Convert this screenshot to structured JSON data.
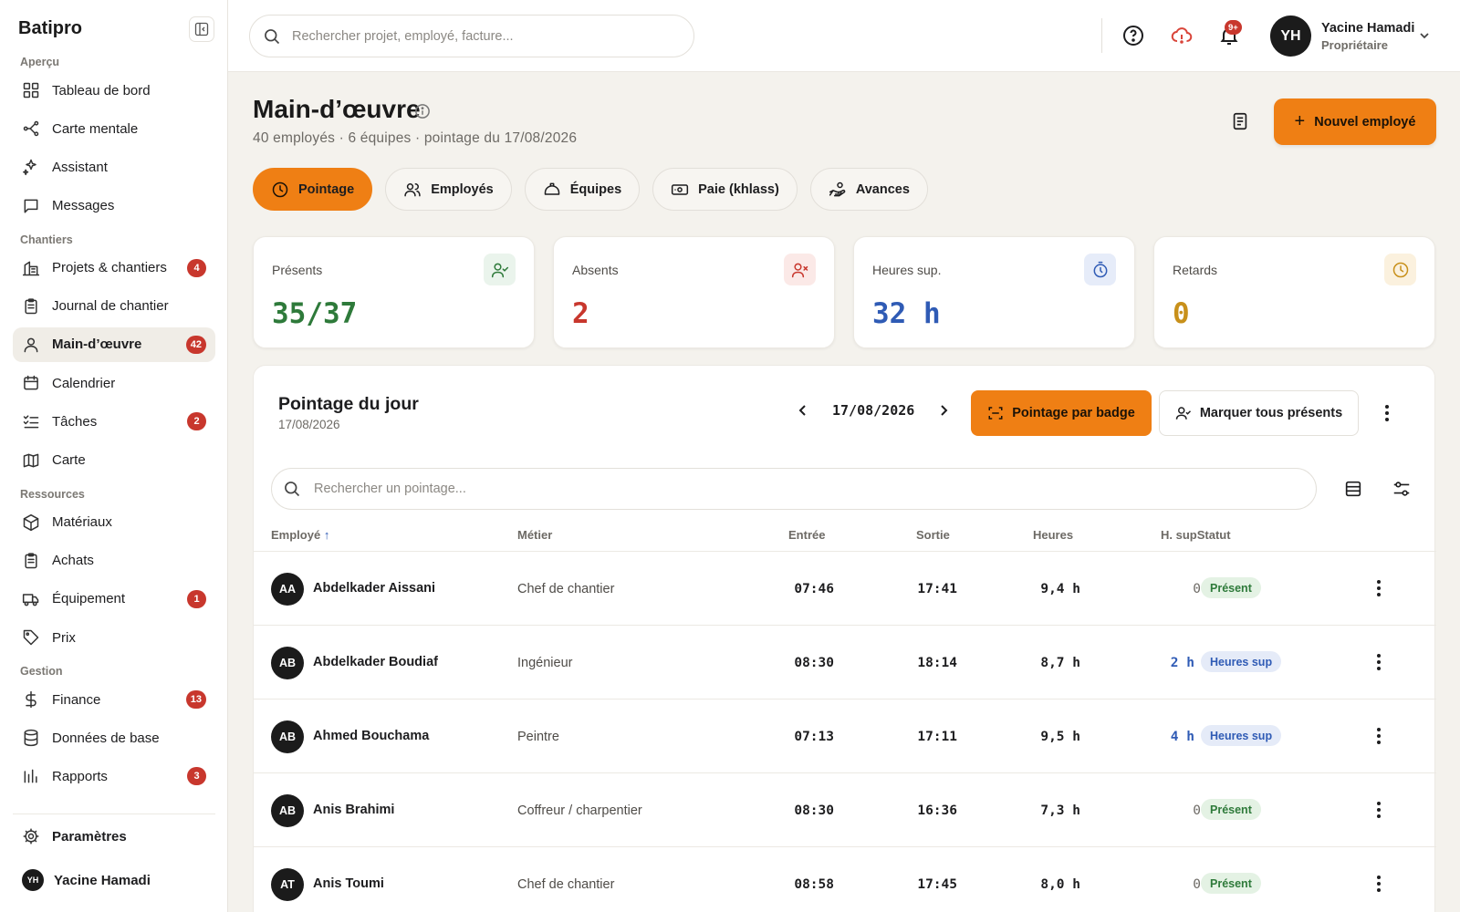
{
  "app": {
    "brand": "Batipro"
  },
  "sidebar": {
    "sections": [
      {
        "title": "Aperçu",
        "items": [
          {
            "label": "Tableau de bord",
            "icon": "dashboard-icon"
          },
          {
            "label": "Carte mentale",
            "icon": "mindmap-icon"
          },
          {
            "label": "Assistant",
            "icon": "sparkles-icon"
          },
          {
            "label": "Messages",
            "icon": "message-icon"
          }
        ]
      },
      {
        "title": "Chantiers",
        "items": [
          {
            "label": "Projets & chantiers",
            "icon": "building-icon",
            "badge": "4"
          },
          {
            "label": "Journal de chantier",
            "icon": "clipboard-icon"
          },
          {
            "label": "Main-d’œuvre",
            "icon": "user-icon",
            "badge": "42",
            "active": true
          },
          {
            "label": "Calendrier",
            "icon": "calendar-icon"
          },
          {
            "label": "Tâches",
            "icon": "checklist-icon",
            "badge": "2"
          },
          {
            "label": "Carte",
            "icon": "map-icon"
          }
        ]
      },
      {
        "title": "Ressources",
        "items": [
          {
            "label": "Matériaux",
            "icon": "box-icon"
          },
          {
            "label": "Achats",
            "icon": "clipboard-icon"
          },
          {
            "label": "Équipement",
            "icon": "truck-icon",
            "badge": "1"
          },
          {
            "label": "Prix",
            "icon": "tag-icon"
          }
        ]
      },
      {
        "title": "Gestion",
        "items": [
          {
            "label": "Finance",
            "icon": "dollar-icon",
            "badge": "13"
          },
          {
            "label": "Données de base",
            "icon": "database-icon"
          },
          {
            "label": "Rapports",
            "icon": "bar-chart-icon",
            "badge": "3"
          }
        ]
      }
    ],
    "settings_label": "Paramètres",
    "user_initials": "YH",
    "user_name": "Yacine Hamadi"
  },
  "topbar": {
    "search_placeholder": "Rechercher projet, employé, facture...",
    "notif_count": "9+",
    "user_initials": "YH",
    "user_name": "Yacine Hamadi",
    "user_role": "Propriétaire"
  },
  "page": {
    "title": "Main-d’œuvre",
    "subtitle": "40 employés · 6 équipes · pointage du 17/08/2026",
    "new_button": "Nouvel employé"
  },
  "tabs": [
    {
      "label": "Pointage",
      "icon": "clock-icon",
      "active": true
    },
    {
      "label": "Employés",
      "icon": "users-icon"
    },
    {
      "label": "Équipes",
      "icon": "helmet-icon"
    },
    {
      "label": "Paie (khlass)",
      "icon": "cash-icon"
    },
    {
      "label": "Avances",
      "icon": "hand-coin-icon"
    }
  ],
  "stats": [
    {
      "label": "Présents",
      "value": "35/37",
      "color": "#2e7a3a",
      "icon": "user-check-icon",
      "icon_bg": "#eaf4ec"
    },
    {
      "label": "Absents",
      "value": "2",
      "color": "#c8372d",
      "icon": "user-x-icon",
      "icon_bg": "#fbe9e7"
    },
    {
      "label": "Heures sup.",
      "value": "32 h",
      "color": "#2f5bb5",
      "icon": "stopwatch-icon",
      "icon_bg": "#e6ecf9"
    },
    {
      "label": "Retards",
      "value": "0",
      "color": "#c8901a",
      "icon": "clock-icon",
      "icon_bg": "#fbf1de"
    }
  ],
  "panel": {
    "title": "Pointage du jour",
    "date": "17/08/2026",
    "current_date": "17/08/2026",
    "badge_button": "Pointage par badge",
    "mark_all_button": "Marquer tous présents",
    "search_placeholder": "Rechercher un pointage...",
    "columns": {
      "employee": "Employé",
      "job": "Métier",
      "in": "Entrée",
      "out": "Sortie",
      "hours": "Heures",
      "ot_status": "H. supStatut"
    },
    "rows": [
      {
        "initials": "AA",
        "name": "Abdelkader Aissani",
        "job": "Chef de chantier",
        "in": "07:46",
        "out": "17:41",
        "hours": "9,4 h",
        "ot": "0",
        "status": "Présent",
        "status_type": "present"
      },
      {
        "initials": "AB",
        "name": "Abdelkader Boudiaf",
        "job": "Ingénieur",
        "in": "08:30",
        "out": "18:14",
        "hours": "8,7 h",
        "ot": "2 h",
        "status": "Heures sup",
        "status_type": "overtime"
      },
      {
        "initials": "AB",
        "name": "Ahmed Bouchama",
        "job": "Peintre",
        "in": "07:13",
        "out": "17:11",
        "hours": "9,5 h",
        "ot": "4 h",
        "status": "Heures sup",
        "status_type": "overtime"
      },
      {
        "initials": "AB",
        "name": "Anis Brahimi",
        "job": "Coffreur / charpentier",
        "in": "08:30",
        "out": "16:36",
        "hours": "7,3 h",
        "ot": "0",
        "status": "Présent",
        "status_type": "present"
      },
      {
        "initials": "AT",
        "name": "Anis Toumi",
        "job": "Chef de chantier",
        "in": "08:58",
        "out": "17:45",
        "hours": "8,0 h",
        "ot": "0",
        "status": "Présent",
        "status_type": "present"
      }
    ]
  }
}
